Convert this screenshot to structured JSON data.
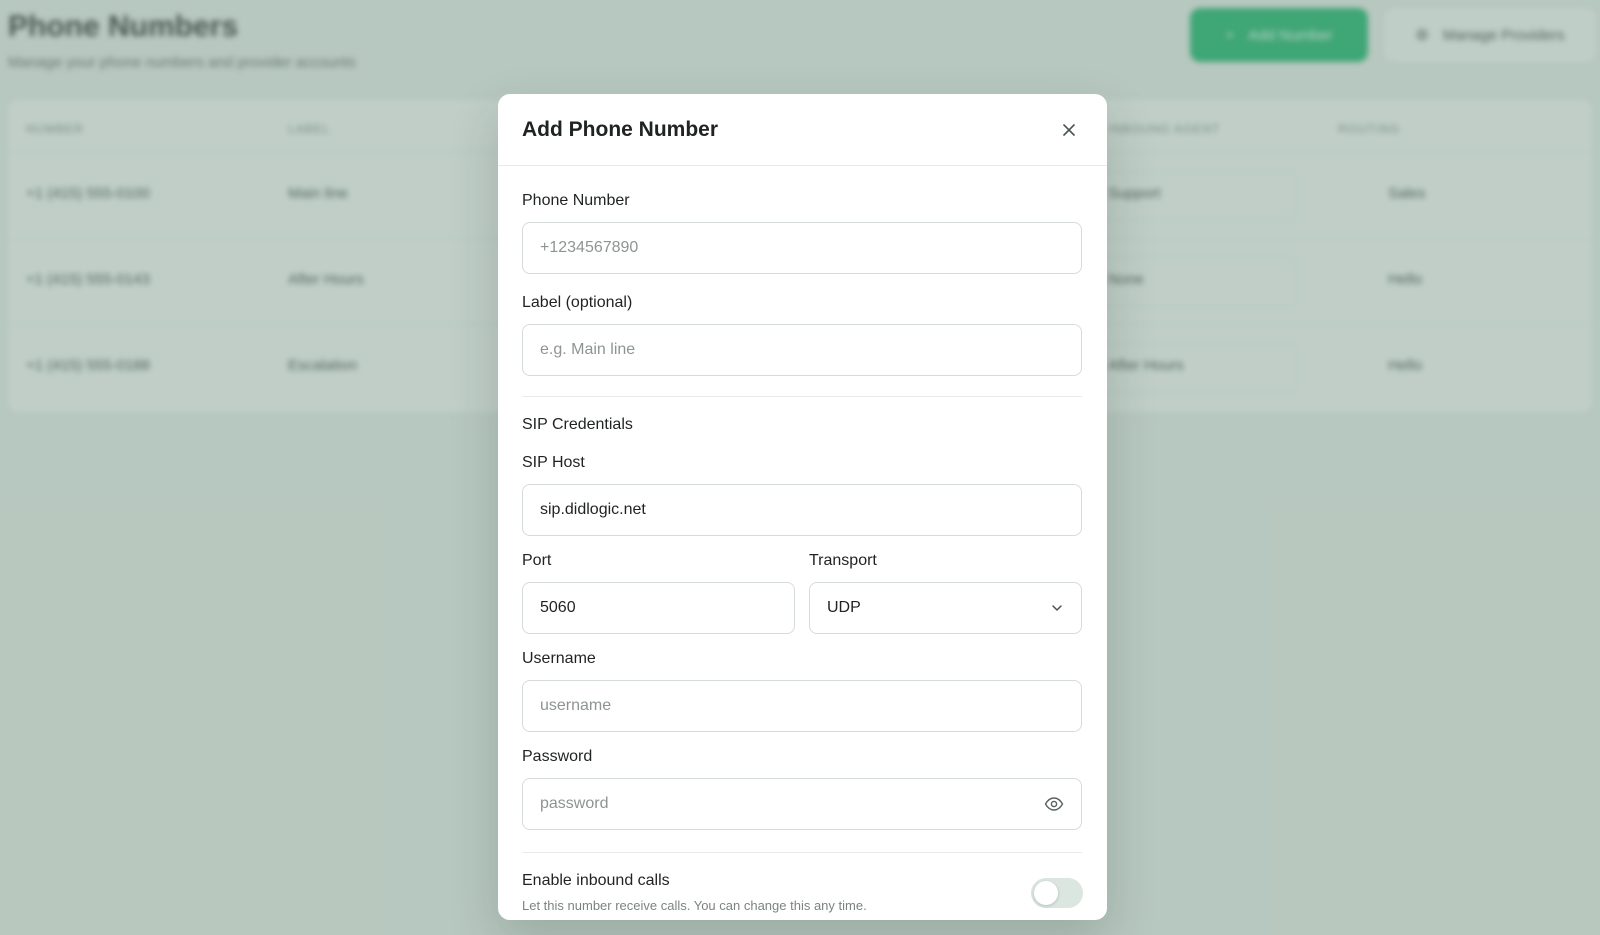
{
  "background": {
    "page_title": "Phone Numbers",
    "page_subtitle": "Manage your phone numbers and provider accounts",
    "add_button_label": "Add Number",
    "manage_button_label": "Manage Providers",
    "table_headers": [
      "Number",
      "Label",
      "Inbound agent",
      "Routing"
    ],
    "rows": [
      {
        "number": "+1 (415) 555-0100",
        "label": "Main line",
        "agent": "Support",
        "routing": "Sales"
      },
      {
        "number": "+1 (415) 555-0143",
        "label": "After Hours",
        "agent": "None",
        "routing": "Hello"
      },
      {
        "number": "+1 (415) 555-0188",
        "label": "Escalation",
        "agent": "After Hours",
        "routing": "Hello"
      }
    ]
  },
  "modal": {
    "title": "Add Phone Number",
    "phone_number": {
      "label": "Phone Number",
      "placeholder": "+1234567890",
      "value": ""
    },
    "label_field": {
      "label": "Label (optional)",
      "placeholder": "e.g. Main line",
      "value": ""
    },
    "sip_section_title": "SIP Credentials",
    "sip_host": {
      "label": "SIP Host",
      "value": "sip.didlogic.net"
    },
    "port": {
      "label": "Port",
      "value": "5060"
    },
    "transport": {
      "label": "Transport",
      "value": "UDP"
    },
    "username": {
      "label": "Username",
      "placeholder": "username",
      "value": ""
    },
    "password": {
      "label": "Password",
      "placeholder": "password",
      "value": ""
    },
    "inbound": {
      "label": "Enable inbound calls",
      "hint": "Let this number receive calls. You can change this any time.",
      "enabled": false
    }
  },
  "colors": {
    "accent": "#18b26a",
    "overlay": "#9fb4a8",
    "toggle_off": "#dbe6e0"
  }
}
